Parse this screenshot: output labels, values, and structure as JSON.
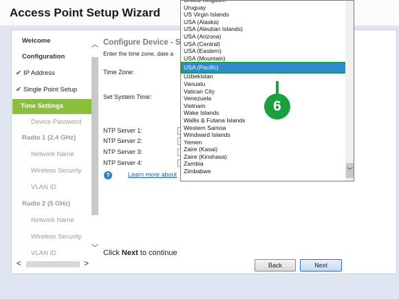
{
  "app": {
    "title": "Access Point Setup Wizard"
  },
  "nav": {
    "items": [
      {
        "label": "Welcome",
        "kind": "section"
      },
      {
        "label": "Configuration",
        "kind": "section"
      },
      {
        "label": "IP Address",
        "kind": "done"
      },
      {
        "label": "Single Point Setup",
        "kind": "done"
      },
      {
        "label": "Time Settings",
        "kind": "active"
      },
      {
        "label": "Device Password",
        "kind": "sub"
      },
      {
        "label": "Radio 1 (2.4 GHz)",
        "kind": "section-muted"
      },
      {
        "label": "Network Name",
        "kind": "sub"
      },
      {
        "label": "Wireless Security",
        "kind": "sub"
      },
      {
        "label": "VLAN ID",
        "kind": "sub"
      },
      {
        "label": "Radio 2 (5 GHz)",
        "kind": "section-muted"
      },
      {
        "label": "Network Name",
        "kind": "sub"
      },
      {
        "label": "Wireless Security",
        "kind": "sub"
      },
      {
        "label": "VLAN ID",
        "kind": "sub"
      }
    ]
  },
  "main": {
    "heading": "Configure Device - S",
    "subtitle": "Enter the time zone, date a",
    "time_zone_label": "Time Zone:",
    "set_time_label": "Set System Time:",
    "ntp_labels": [
      "NTP Server 1:",
      "NTP Server 2:",
      "NTP Server 3:",
      "NTP Server 4:"
    ],
    "learn_more": "Learn more about",
    "continue_prefix": "Click ",
    "continue_bold": "Next",
    "continue_suffix": " to continue"
  },
  "buttons": {
    "back": "Back",
    "next": "Next"
  },
  "dropdown": {
    "options": [
      "United Kingdom",
      "Uruguay",
      "US Virgin Islands",
      "USA (Alaska)",
      "USA (Aleutian Islands)",
      "USA (Arizona)",
      "USA (Central)",
      "USA (Eastern)",
      "USA (Mountain)",
      "USA (Pacific)",
      "Uzbekistan",
      "Vanuatu",
      "Vatican City",
      "Venezuela",
      "Vietnam",
      "Wake Islands",
      "Wallis & Futana Islands",
      "Western Samoa",
      "Windward Islands",
      "Yemen",
      "Zaire (Kasai)",
      "Zaire (Kinshasa)",
      "Zambia",
      "Zimbabwe"
    ],
    "selected": "USA (Pacific)"
  },
  "callout": {
    "step": "6"
  },
  "colors": {
    "active_nav": "#8bbe3c",
    "selection": "#2e8bcb",
    "callout": "#1c9f3e",
    "link": "#1f5ca8"
  }
}
